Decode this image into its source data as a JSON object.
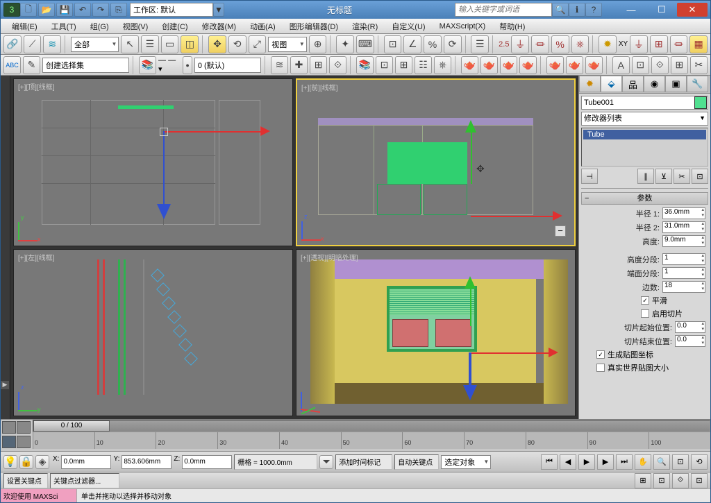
{
  "titlebar": {
    "workspace_label": "工作区: 默认",
    "title": "无标题",
    "search_placeholder": "输入关键字或词语"
  },
  "menu": [
    "编辑(E)",
    "工具(T)",
    "组(G)",
    "视图(V)",
    "创建(C)",
    "修改器(M)",
    "动画(A)",
    "图形编辑器(D)",
    "渲染(R)",
    "自定义(U)",
    "MAXScript(X)",
    "帮助(H)"
  ],
  "toolbar1": {
    "filter": "全部",
    "refcoord": "视图",
    "spinner_right": "2.5"
  },
  "toolbar2": {
    "named_sel": "创建选择集",
    "layer": "0 (默认)"
  },
  "viewports": {
    "top": "[+][顶][线框]",
    "front": "[+][前][线框]",
    "left": "[+][左][线框]",
    "persp": "[+][透视][明暗处理]"
  },
  "panel": {
    "object_name": "Tube001",
    "mod_list_label": "修改器列表",
    "stack_item": "Tube",
    "rollout_title": "参数",
    "params": {
      "radius1_lbl": "半径 1:",
      "radius1": "36.0mm",
      "radius2_lbl": "半径 2:",
      "radius2": "31.0mm",
      "height_lbl": "高度:",
      "height": "9.0mm",
      "hsegs_lbl": "高度分段:",
      "hsegs": "1",
      "capsegs_lbl": "端面分段:",
      "capsegs": "1",
      "sides_lbl": "边数:",
      "sides": "18",
      "smooth": "平滑",
      "slice_on": "启用切片",
      "slice_from_lbl": "切片起始位置:",
      "slice_from": "0.0",
      "slice_to_lbl": "切片结束位置:",
      "slice_to": "0.0",
      "gen_uv": "生成贴图坐标",
      "real_world": "真实世界贴图大小"
    }
  },
  "timeline": {
    "handle": "0 / 100",
    "ticks": [
      "0",
      "10",
      "20",
      "30",
      "40",
      "50",
      "60",
      "70",
      "80",
      "90",
      "100"
    ]
  },
  "status": {
    "x": "0.0mm",
    "y": "853.606mm",
    "z": "0.0mm",
    "grid": "栅格 = 1000.0mm",
    "add_time": "添加时间标记",
    "autokey": "自动关键点",
    "setkey": "设置关键点",
    "selected": "选定对象",
    "keyfilter": "关键点过滤器..."
  },
  "prompt": {
    "welcome": "欢迎使用  MAXSci",
    "hint": "单击并拖动以选择并移动对象"
  }
}
